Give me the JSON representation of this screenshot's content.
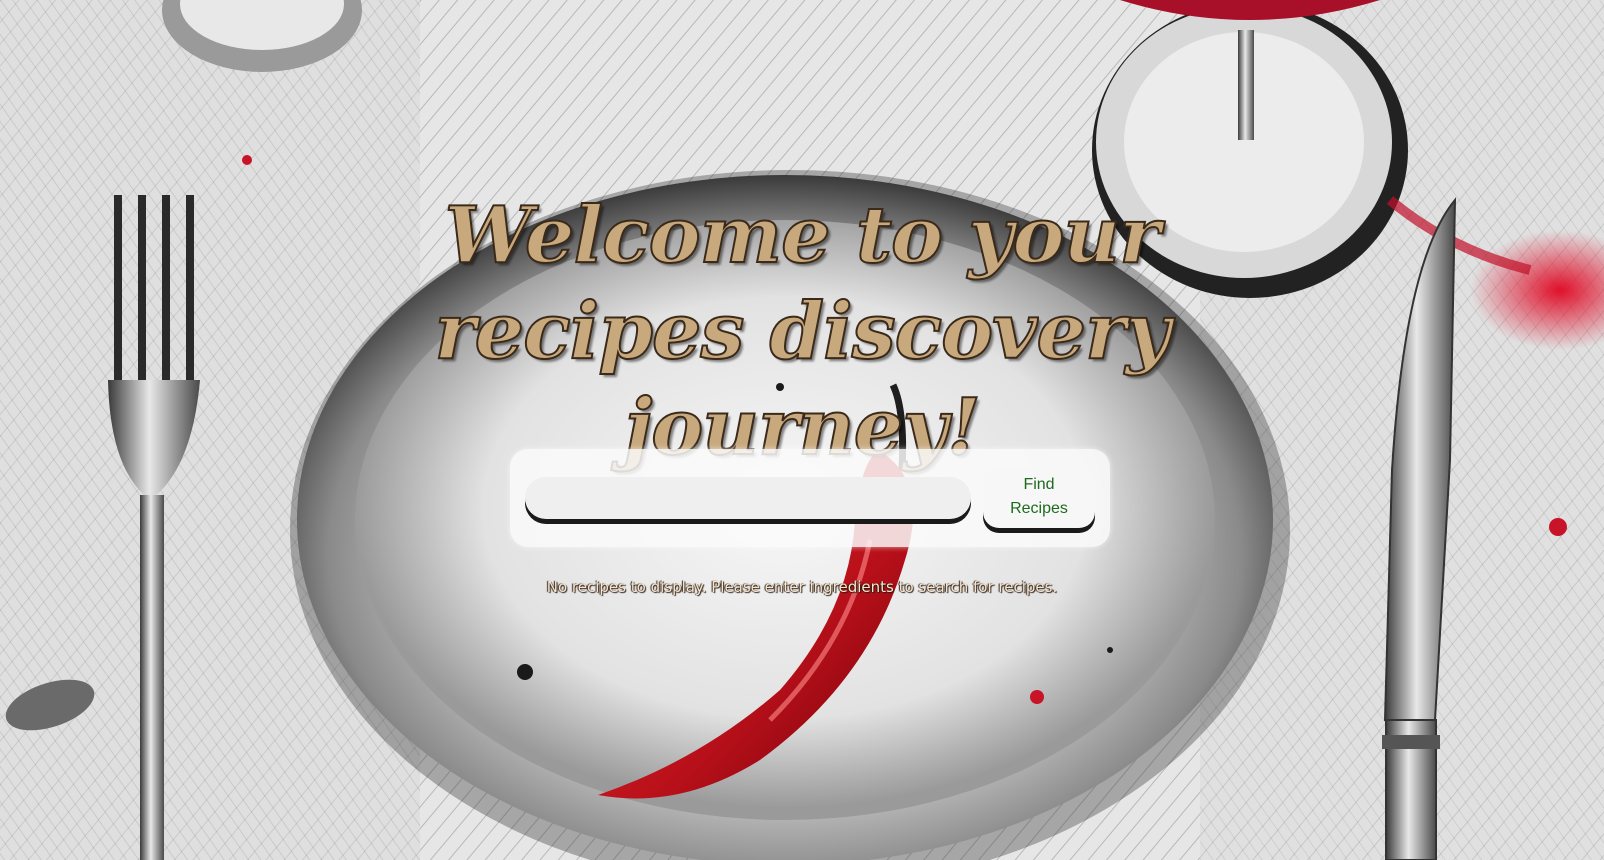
{
  "header": {
    "title": "Welcome to your recipes discovery journey!"
  },
  "search": {
    "placeholder": "",
    "value": "",
    "button_label": "Find Recipes"
  },
  "results": {
    "empty_message": "No recipes to display. Please enter ingredients to search for recipes."
  },
  "colors": {
    "title_fill": "#c8a97e",
    "title_outline": "#3b2a1a",
    "button_text": "#1d6b1d",
    "chili_red": "#c8141e",
    "wine_red": "#d4142a"
  },
  "background": {
    "icon": "table-setting-illustration"
  }
}
